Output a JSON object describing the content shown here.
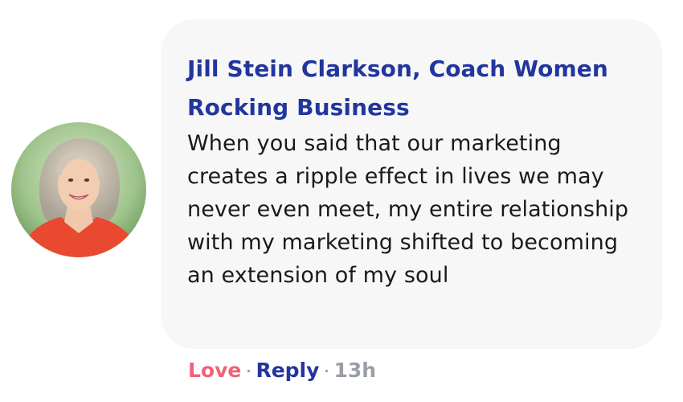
{
  "comment": {
    "author": "Jill Stein Clarkson, Coach Women Rocking Business",
    "text": "When you said that our marketing creates a ripple effect in lives we may never even meet, my entire relationship with my marketing shifted to becoming an extension of my soul",
    "avatar_icon": "profile-photo"
  },
  "actions": {
    "love_label": "Love",
    "separator": "·",
    "reply_label": "Reply",
    "timestamp": "13h"
  },
  "colors": {
    "author": "#22369d",
    "love": "#f06277",
    "reply": "#22369d",
    "timestamp": "#9a9ea6",
    "bubble": "#f7f7f7"
  }
}
